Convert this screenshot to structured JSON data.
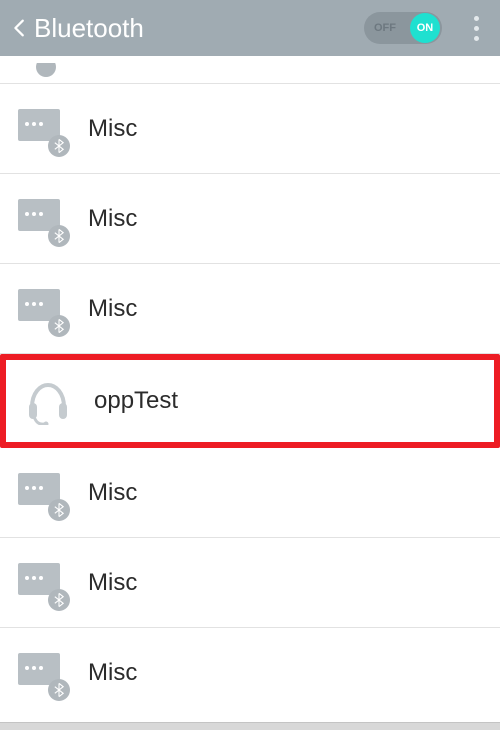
{
  "header": {
    "title": "Bluetooth",
    "toggle_off_label": "OFF",
    "toggle_on_label": "ON",
    "toggle_state": "on"
  },
  "devices": [
    {
      "label": "Misc",
      "type": "misc",
      "highlighted": false
    },
    {
      "label": "Misc",
      "type": "misc",
      "highlighted": false
    },
    {
      "label": "Misc",
      "type": "misc",
      "highlighted": false
    },
    {
      "label": "oppTest",
      "type": "headset",
      "highlighted": true
    },
    {
      "label": "Misc",
      "type": "misc",
      "highlighted": false
    },
    {
      "label": "Misc",
      "type": "misc",
      "highlighted": false
    },
    {
      "label": "Misc",
      "type": "misc",
      "highlighted": false
    }
  ],
  "colors": {
    "header_bg": "#a0abb2",
    "toggle_on": "#1fe0d0",
    "highlight": "#ed1c24"
  }
}
